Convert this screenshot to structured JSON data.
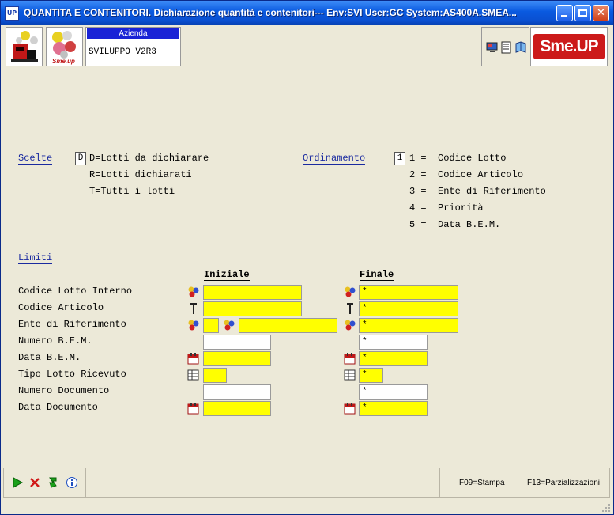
{
  "window": {
    "app_icon": "UP",
    "title": "QUANTITA E CONTENITORI.  Dichiarazione quantità e contenitori--- Env:SVI User:GC System:AS400A.SMEA..."
  },
  "toolbar": {
    "azienda_label": "Azienda",
    "azienda_value": "SVILUPPO V2R3",
    "brand": "Sme.UP",
    "logo2_text": "Sme.up"
  },
  "scelte": {
    "label": "Scelte",
    "value": "D",
    "options": [
      "D=Lotti da dichiarare",
      "R=Lotti dichiarati",
      "T=Tutti i lotti"
    ]
  },
  "ordinamento": {
    "label": "Ordinamento",
    "value": "1",
    "options": [
      "1 =  Codice Lotto",
      "2 =  Codice Articolo",
      "3 =  Ente di Riferimento",
      "4 =  Priorità",
      "5 =  Data B.E.M."
    ]
  },
  "limiti": {
    "label": "Limiti",
    "col_iniziale": "Iniziale",
    "col_finale": "Finale",
    "rows": [
      {
        "label": "Codice Lotto Interno",
        "icon": "objects-icon",
        "iniziale": "",
        "finale": "*"
      },
      {
        "label": "Codice Articolo",
        "icon": "pin-icon",
        "iniziale": "",
        "finale": "*"
      },
      {
        "label": "Ente di Riferimento",
        "icon": "objects-icon",
        "iniziale_a": "",
        "iniziale_b": "",
        "finale": "*"
      },
      {
        "label": "Numero B.E.M.",
        "icon": "",
        "iniziale": "",
        "finale": "*"
      },
      {
        "label": "Data B.E.M.",
        "icon": "calendar-icon",
        "iniziale": "",
        "finale": "*"
      },
      {
        "label": "Tipo Lotto Ricevuto",
        "icon": "table-icon",
        "iniziale": "",
        "finale": "*"
      },
      {
        "label": "Numero Documento",
        "icon": "",
        "iniziale": "",
        "finale": "*"
      },
      {
        "label": "Data Documento",
        "icon": "calendar-icon",
        "iniziale": "",
        "finale": "*"
      }
    ]
  },
  "statusbar": {
    "f09": "F09=Stampa",
    "f13": "F13=Parzializzazioni"
  }
}
